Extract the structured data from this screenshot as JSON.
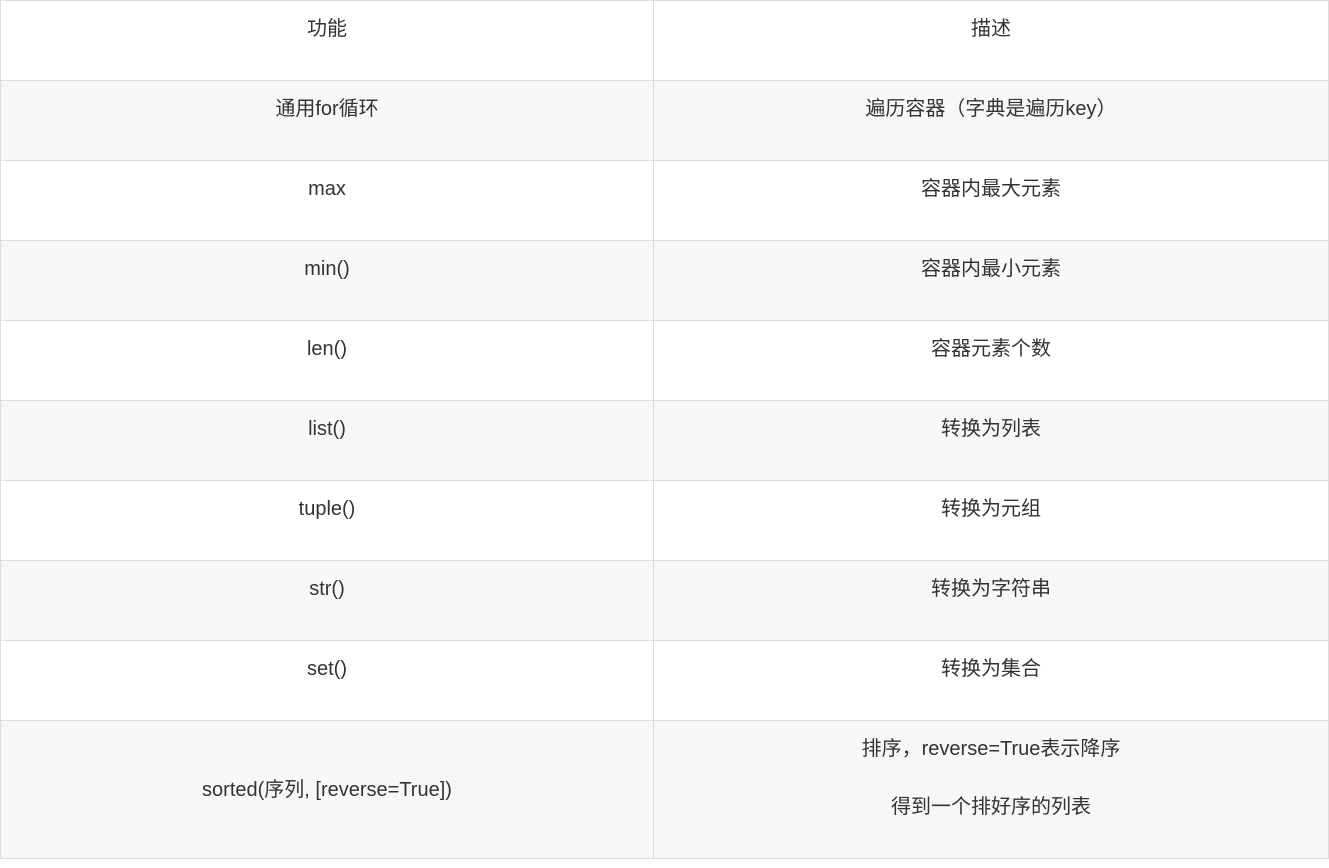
{
  "table": {
    "headers": [
      "功能",
      "描述"
    ],
    "rows": [
      {
        "func": "通用for循环",
        "desc": [
          "遍历容器（字典是遍历key）"
        ]
      },
      {
        "func": "max",
        "desc": [
          "容器内最大元素"
        ]
      },
      {
        "func": "min()",
        "desc": [
          "容器内最小元素"
        ]
      },
      {
        "func": "len()",
        "desc": [
          "容器元素个数"
        ]
      },
      {
        "func": "list()",
        "desc": [
          "转换为列表"
        ]
      },
      {
        "func": "tuple()",
        "desc": [
          "转换为元组"
        ]
      },
      {
        "func": "str()",
        "desc": [
          "转换为字符串"
        ]
      },
      {
        "func": "set()",
        "desc": [
          "转换为集合"
        ]
      },
      {
        "func": "sorted(序列, [reverse=True])",
        "desc": [
          "排序，reverse=True表示降序",
          "得到一个排好序的列表"
        ]
      }
    ]
  },
  "colors": {
    "text": "#333333",
    "border": "#dddddd",
    "stripe": "#f7f7f7",
    "background": "#ffffff"
  }
}
